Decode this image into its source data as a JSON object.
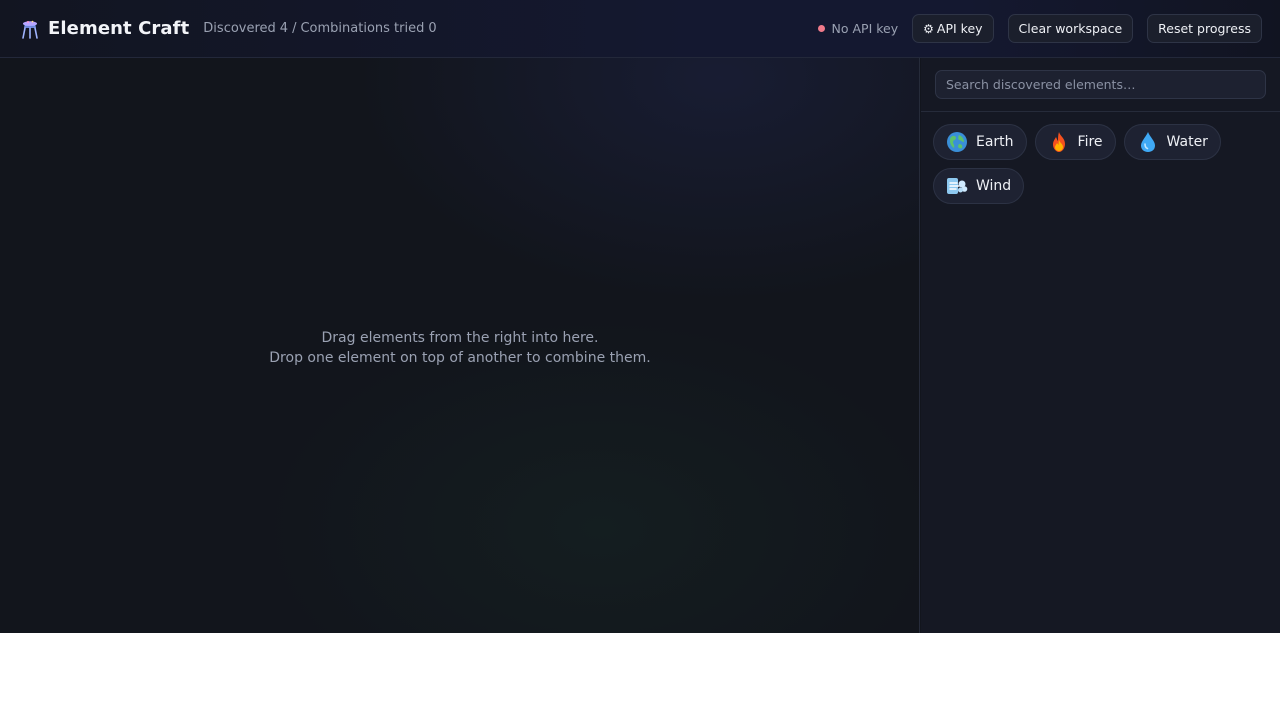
{
  "header": {
    "app_title": "Element Craft",
    "stats": {
      "discovered_label": "Discovered",
      "discovered_count": "4",
      "separator": "/",
      "tried_label": "Combinations tried",
      "tried_count": "0"
    },
    "api_status": {
      "text": "No API key",
      "dot_color": "#f07a8a"
    },
    "buttons": {
      "api_key_icon": "gear-icon",
      "api_key_glyph": "⚙",
      "api_key_label": "API key",
      "clear_label": "Clear workspace",
      "reset_label": "Reset progress"
    }
  },
  "workspace": {
    "hint_line1": "Drag elements from the right into here.",
    "hint_line2": "Drop one element on top of another to combine them."
  },
  "sidebar": {
    "search_placeholder": "Search discovered elements…",
    "elements": [
      {
        "label": "Earth",
        "icon": "earth-globe-icon"
      },
      {
        "label": "Fire",
        "icon": "fire-icon"
      },
      {
        "label": "Water",
        "icon": "water-drop-icon"
      },
      {
        "label": "Wind",
        "icon": "wind-icon"
      }
    ]
  },
  "colors": {
    "background": "#12151c",
    "panel": "#151823",
    "accent_status": "#f07a8a"
  }
}
